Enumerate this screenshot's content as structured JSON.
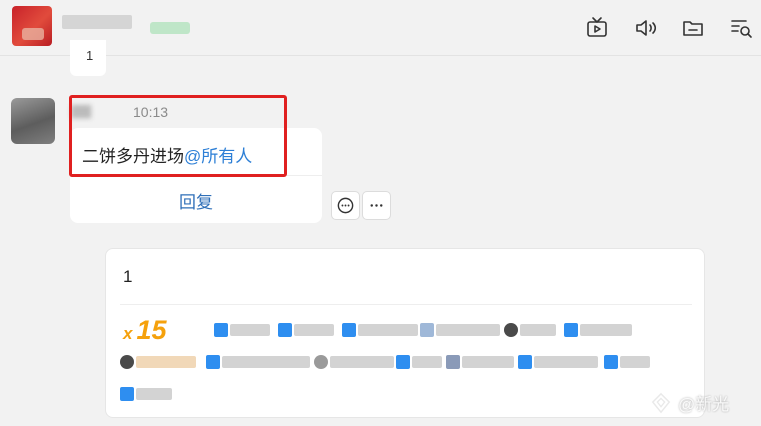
{
  "header": {
    "icons": [
      "tv-icon",
      "voice-icon",
      "folder-icon",
      "search-history-icon"
    ]
  },
  "previous_message": {
    "text": "1"
  },
  "message": {
    "time": "10:13",
    "text": "二饼多丹进场",
    "mention": "@所有人",
    "reply_label": "回复"
  },
  "reply_panel": {
    "value": "1",
    "count_prefix": "x",
    "count": "15"
  },
  "watermark": {
    "text": "@新光"
  },
  "colors": {
    "highlight": "#e02020",
    "mention": "#2d7fd6",
    "count": "#f5a10c"
  }
}
